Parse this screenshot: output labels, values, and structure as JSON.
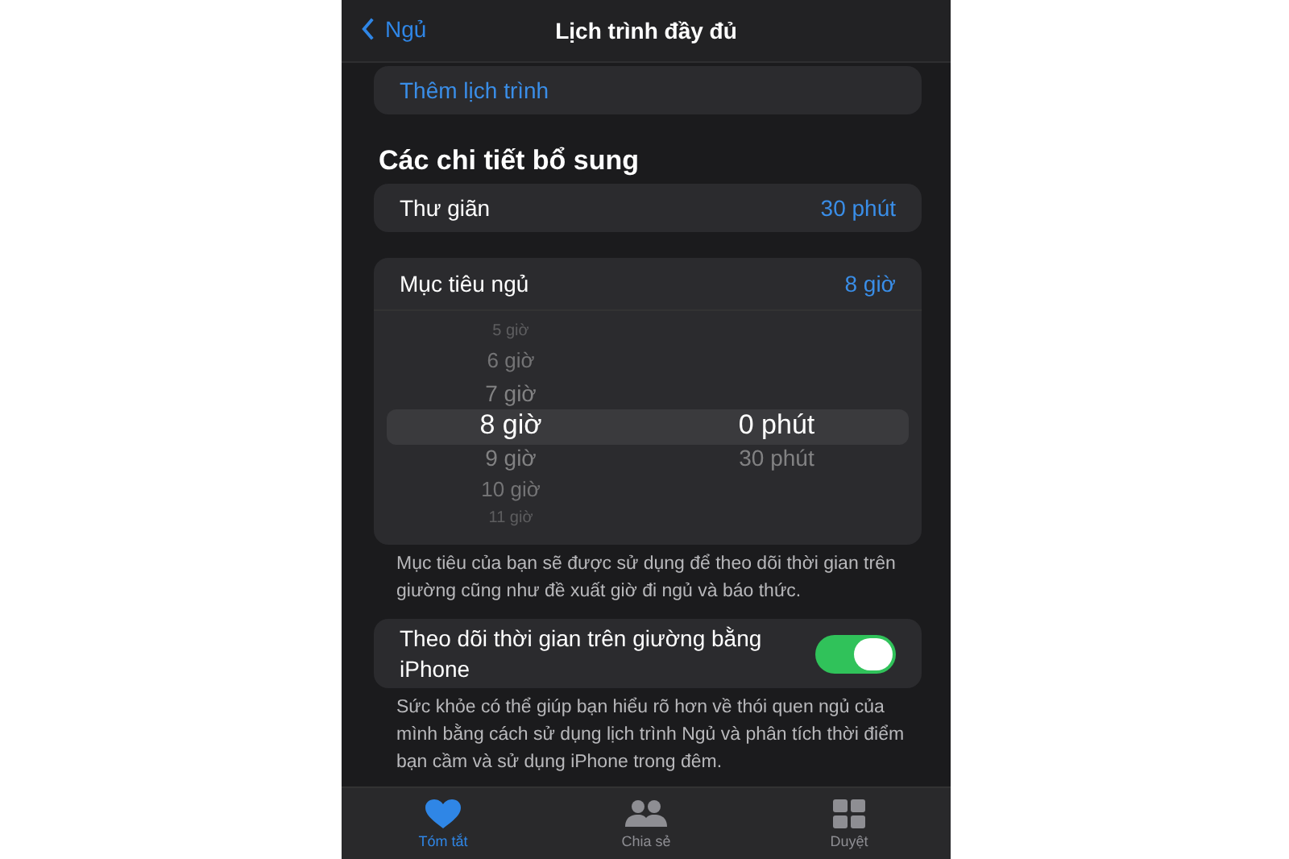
{
  "nav": {
    "back": "Ngủ",
    "title": "Lịch trình đầy đủ"
  },
  "add_schedule": "Thêm lịch trình",
  "section_title": "Các chi tiết bổ sung",
  "wind_down": {
    "label": "Thư giãn",
    "value": "30 phút"
  },
  "sleep_goal": {
    "label": "Mục tiêu ngủ",
    "value": "8 giờ",
    "hours": [
      {
        "label": "5 giờ",
        "selected": false
      },
      {
        "label": "6 giờ",
        "selected": false
      },
      {
        "label": "7 giờ",
        "selected": false
      },
      {
        "label": "8 giờ",
        "selected": true
      },
      {
        "label": "9 giờ",
        "selected": false
      },
      {
        "label": "10 giờ",
        "selected": false
      },
      {
        "label": "11 giờ",
        "selected": false
      }
    ],
    "minutes": [
      {
        "label": "0 phút",
        "selected": true
      },
      {
        "label": "30 phút",
        "selected": false
      }
    ]
  },
  "goal_note": "Mục tiêu của bạn sẽ được sử dụng để theo dõi thời gian trên giường cũng như đề xuất giờ đi ngủ và báo thức.",
  "track_toggle": {
    "label": "Theo dõi thời gian trên giường bằng iPhone",
    "on": true
  },
  "track_note": "Sức khỏe có thể giúp bạn hiểu rõ hơn về thói quen ngủ của mình bằng cách sử dụng lịch trình Ngủ và phân tích thời điểm bạn cầm và sử dụng iPhone trong đêm.",
  "tabs": [
    {
      "label": "Tóm tắt",
      "kind": "heart",
      "selected": true
    },
    {
      "label": "Chia sẻ",
      "kind": "people",
      "selected": false
    },
    {
      "label": "Duyệt",
      "kind": "grid",
      "selected": false
    }
  ]
}
